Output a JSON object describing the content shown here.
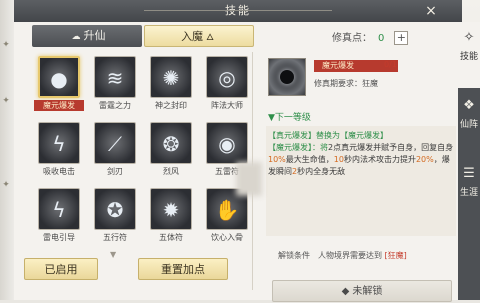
{
  "window": {
    "title": "技能",
    "close_icon": "×"
  },
  "tabs": [
    {
      "label": "升仙",
      "icon": "cloud-icon"
    },
    {
      "label": "入魔",
      "icon": "flame-icon"
    }
  ],
  "points": {
    "label": "修真点：",
    "value": "0",
    "add_label": "+"
  },
  "skills": [
    {
      "name": "魔元爆发",
      "glyph": "●",
      "selected": true
    },
    {
      "name": "雷霆之力",
      "glyph": "≋"
    },
    {
      "name": "神之封印",
      "glyph": "✺"
    },
    {
      "name": "阵法大师",
      "glyph": "◎"
    },
    {
      "name": "吸收电击",
      "glyph": "ϟ"
    },
    {
      "name": "剑刃",
      "glyph": "⟋"
    },
    {
      "name": "烈风",
      "glyph": "❂"
    },
    {
      "name": "五雷符",
      "glyph": "◉"
    },
    {
      "name": "雷电引导",
      "glyph": "ϟ"
    },
    {
      "name": "五行符",
      "glyph": "✪"
    },
    {
      "name": "五体符",
      "glyph": "✹"
    },
    {
      "name": "饮心入骨",
      "glyph": "✋"
    }
  ],
  "buttons": {
    "enabled": "已启用",
    "reset": "重置加点",
    "locked": "◆ 未解锁"
  },
  "detail": {
    "name": "魔元爆发",
    "level": "0/1",
    "requirement": "修真期要求：狂魔",
    "next_level_title": "▼下一等级",
    "desc_line1_a": "【真元爆发】替换为【",
    "desc_line1_b": "魔元爆发",
    "desc_line1_c": "】",
    "desc_line2_a": "【魔元爆发】：将",
    "desc_line2_b": "2",
    "desc_line2_c": "点真元爆发并赋予自身，回复自身",
    "desc_line2_d": "10%",
    "desc_line2_e": "最大生命值，",
    "desc_line2_f": "10",
    "desc_line2_g": "秒内法术攻击力提升",
    "desc_line2_h": "20%",
    "desc_line2_i": "，爆发瞬间",
    "desc_line2_j": "2",
    "desc_line2_k": "秒内全身无敌",
    "unlock_label": "解锁条件　人物境界需要达到",
    "unlock_value": "[狂魔]"
  },
  "side_nav": [
    {
      "label": "技能",
      "icon": "book-icon"
    },
    {
      "label": "仙阵",
      "icon": "array-icon"
    },
    {
      "label": "生涯",
      "icon": "scroll-icon"
    }
  ]
}
